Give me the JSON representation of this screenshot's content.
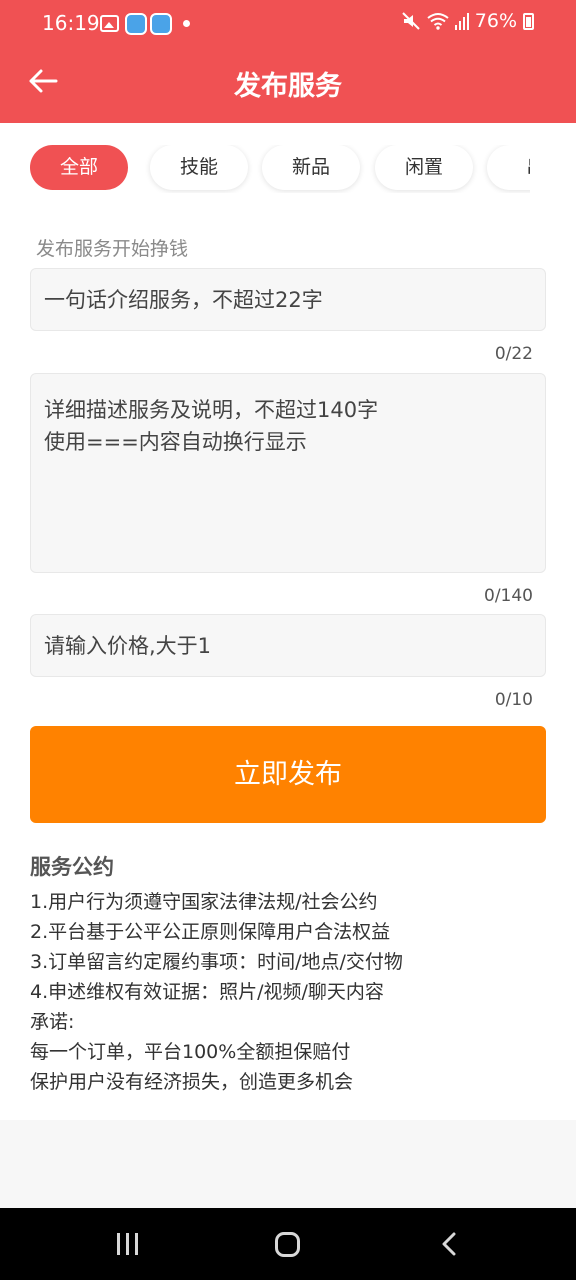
{
  "status_bar": {
    "time": "16:19",
    "battery": "76%",
    "icons": [
      "gallery-icon",
      "app-notification-icon",
      "app-notification-icon",
      "dot-icon",
      "mute-icon",
      "wifi-icon",
      "signal-icon",
      "battery-icon"
    ]
  },
  "header": {
    "title": "发布服务",
    "back_icon": "arrow-left-icon"
  },
  "tabs": [
    {
      "label": "全部",
      "active": true
    },
    {
      "label": "技能",
      "active": false
    },
    {
      "label": "新品",
      "active": false
    },
    {
      "label": "闲置",
      "active": false
    },
    {
      "label": "出",
      "active": false
    }
  ],
  "form": {
    "hint": "发布服务开始挣钱",
    "title_placeholder": "一句话介绍服务，不超过22字",
    "title_counter": "0/22",
    "desc_placeholder_line1": "详细描述服务及说明，不超过140字",
    "desc_placeholder_line2": "使用===内容自动换行显示",
    "desc_counter": "0/140",
    "price_placeholder": "请输入价格,大于1",
    "price_counter": "0/10",
    "submit_label": "立即发布"
  },
  "rules": {
    "title": "服务公约",
    "lines": [
      "1.用户行为须遵守国家法律法规/社会公约",
      "2.平台基于公平公正原则保障用户合法权益",
      "3.订单留言约定履约事项：时间/地点/交付物",
      "4.申述维权有效证据：照片/视频/聊天内容",
      "承诺:",
      "每一个订单，平台100%全额担保赔付",
      "保护用户没有经济损失，创造更多机会"
    ]
  },
  "colors": {
    "brand_red": "#f05153",
    "button_orange": "#ff8200"
  },
  "nav_bar": {
    "icons": [
      "recent-apps-icon",
      "home-icon",
      "back-icon"
    ]
  }
}
